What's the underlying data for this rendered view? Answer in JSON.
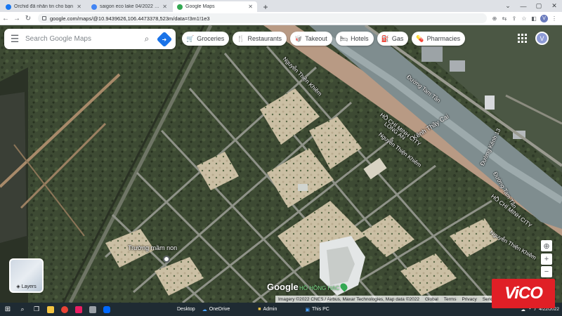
{
  "browser": {
    "tabs": [
      {
        "title": "Orchid đã nhắn tin cho bạn",
        "color": "#1877f2",
        "active": false
      },
      {
        "title": "saigon eco lake 04/2022 - Googl",
        "color": "#4285f4",
        "active": false
      },
      {
        "title": "Google Maps",
        "color": "#34a853",
        "active": true
      }
    ],
    "new_tab": "+",
    "url": "google.com/maps/@10.9439626,106.4473378,523m/data=!3m1!1e3",
    "profile_initial": "V"
  },
  "search": {
    "placeholder": "Search Google Maps"
  },
  "chips": [
    {
      "label": "Groceries",
      "icon": "cart-icon",
      "glyph": "🛒"
    },
    {
      "label": "Restaurants",
      "icon": "restaurant-icon",
      "glyph": "🍴"
    },
    {
      "label": "Takeout",
      "icon": "takeout-icon",
      "glyph": "🥡"
    },
    {
      "label": "Hotels",
      "icon": "hotel-icon",
      "glyph": "🛏"
    },
    {
      "label": "Gas",
      "icon": "gas-icon",
      "glyph": "⛽"
    },
    {
      "label": "Pharmacies",
      "icon": "pharmacy-icon",
      "glyph": "💊"
    }
  ],
  "account_initial": "V",
  "map_labels": {
    "road_kenh": "Đường Tam Tân",
    "hcmc_1": "HỒ CHÍ MINH CITY",
    "long_an": "LONG AN",
    "kenh_thay_cai": "Kênh Thầy Cai",
    "nguyen_thien_khiem_1": "Nguyễn Thiện Khiêm",
    "nguyen_thien_khiem_2": "Nguyễn Thiện Khiêm",
    "duong_kenh13": "Đường Kênh 13",
    "duong_tam_tan_2": "Đường Tam Tân",
    "hcmc_2": "HỒ CHÍ MINH CITY",
    "nguyen_thien_khiem_3": "Nguyễn Thiện Khiêm",
    "school": "Trường mầm non",
    "lake": "HỒ HỒNG HẠC"
  },
  "layers_label": "Layers",
  "google_logo": "Google",
  "attribution": [
    "Imagery ©2022 CNES / Airbus, Maxar Technologies, Map data ©2022",
    "Global",
    "Terms",
    "Privacy",
    "Send fe"
  ],
  "watermark": "ViCO",
  "taskbar": {
    "desktop": "Desktop",
    "onedrive": "OneDrive",
    "admin": "Admin",
    "thispc": "This PC",
    "date": "4/22/2022"
  }
}
